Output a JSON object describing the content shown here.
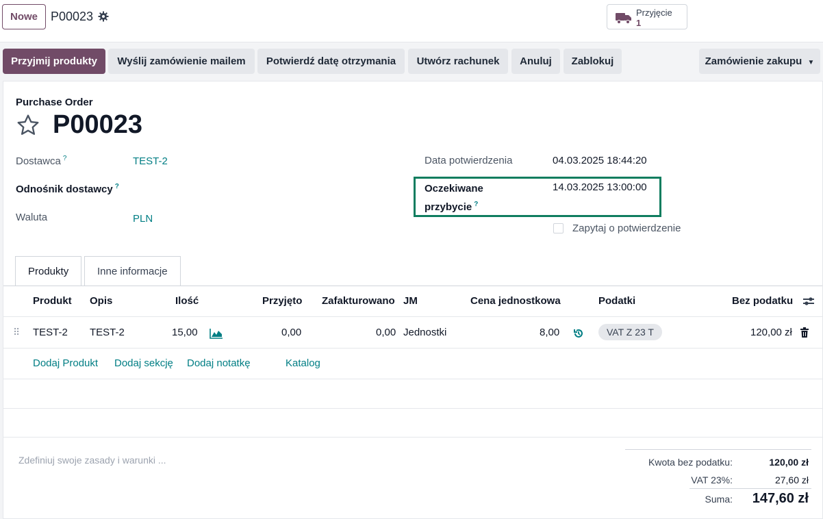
{
  "topbar": {
    "new_label": "Nowe",
    "record_name": "P00023",
    "smart_button": {
      "label": "Przyjęcie",
      "value": "1"
    }
  },
  "actions": {
    "receive": "Przyjmij produkty",
    "send_email": "Wyślij zamówienie mailem",
    "confirm_date": "Potwierdź datę otrzymania",
    "create_bill": "Utwórz rachunek",
    "cancel": "Anuluj",
    "lock": "Zablokuj",
    "print_menu": "Zamówienie zakupu"
  },
  "form": {
    "doc_type": "Purchase Order",
    "title": "P00023",
    "vendor_label": "Dostawca",
    "vendor_value": "TEST-2",
    "vendor_ref_label": "Odnośnik dostawcy",
    "currency_label": "Waluta",
    "currency_value": "PLN",
    "confirm_date_label": "Data potwierdzenia",
    "confirm_date_value": "04.03.2025 18:44:20",
    "expected_label_1": "Oczekiwane",
    "expected_label_2": "przybycie",
    "expected_value": "14.03.2025 13:00:00",
    "ask_confirmation_label": "Zapytaj o potwierdzenie",
    "help_mark": "?"
  },
  "tabs": [
    "Produkty",
    "Inne informacje"
  ],
  "table": {
    "headers": [
      "Produkt",
      "Opis",
      "Ilość",
      "Przyjęto",
      "Zafakturowano",
      "JM",
      "Cena jednostkowa",
      "Podatki",
      "Bez podatku"
    ],
    "row": {
      "product": "TEST-2",
      "description": "TEST-2",
      "qty": "15,00",
      "received": "0,00",
      "invoiced": "0,00",
      "uom": "Jednostki",
      "price": "8,00",
      "tax": "VAT Z 23 T",
      "subtotal": "120,00 zł"
    },
    "add_product": "Dodaj Produkt",
    "add_section": "Dodaj sekcję",
    "add_note": "Dodaj notatkę",
    "catalog": "Katalog"
  },
  "footer": {
    "terms_placeholder": "Zdefiniuj swoje zasady i warunki ...",
    "untaxed_label": "Kwota bez podatku:",
    "untaxed_value": "120,00 zł",
    "vat_label": "VAT 23%:",
    "vat_value": "27,60 zł",
    "total_label": "Suma:",
    "total_value": "147,60 zł"
  },
  "colors": {
    "brand": "#714b67",
    "link": "#017e84",
    "highlight": "#0f7d5f"
  }
}
